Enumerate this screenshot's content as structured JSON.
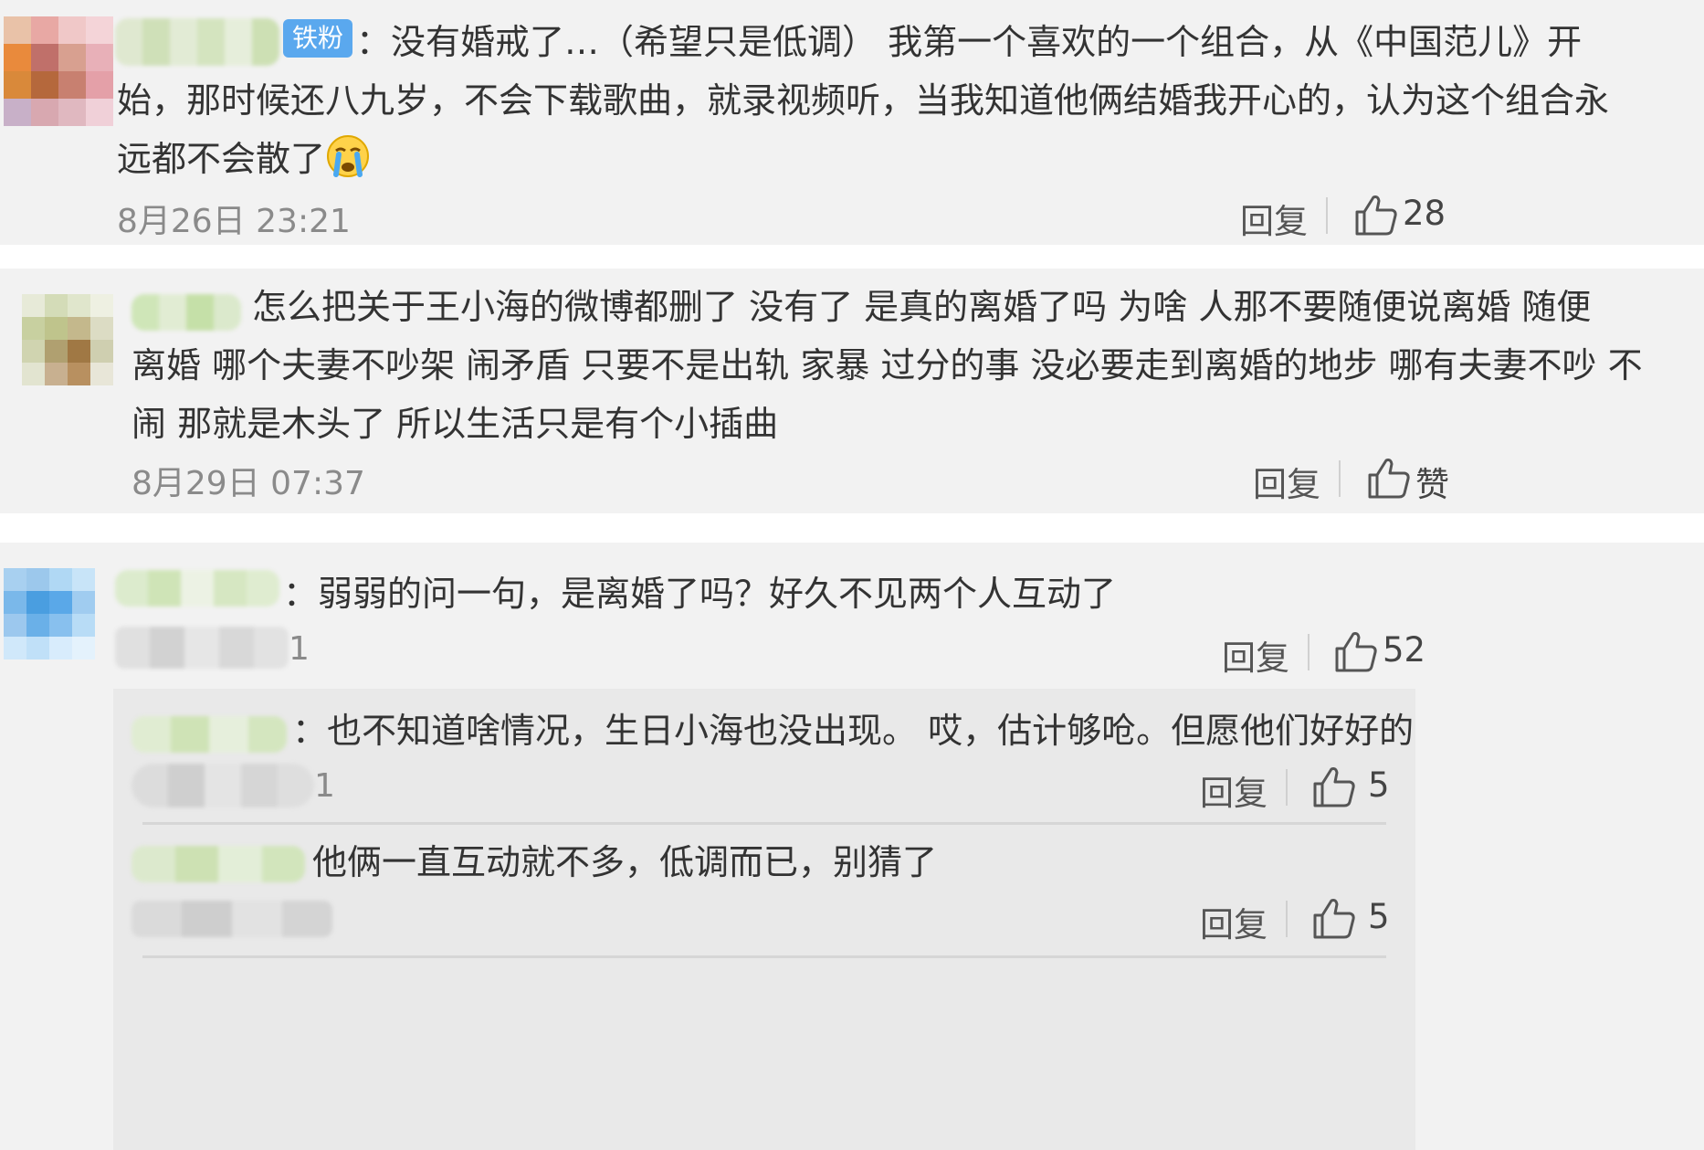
{
  "comments": [
    {
      "badge": "铁粉",
      "text_line1": "：没有婚戒了…（希望只是低调） 我第一个喜欢的一个组合，从《中国范儿》开",
      "text_line2": "始，那时候还八九岁，不会下载歌曲，就录视频听，当我知道他俩结婚我开心的，认为这个组合永",
      "text_line3": "远都不会散了",
      "emoji": "cry-emoji",
      "time": "8月26日 23:21",
      "reply_label": "回复",
      "like_count": "28"
    },
    {
      "text_line1": "怎么把关于王小海的微博都删了 没有了 是真的离婚了吗 为啥 人那不要随便说离婚 随便",
      "text_line2": "离婚 哪个夫妻不吵架 闹矛盾 只要不是出轨 家暴 过分的事 没必要走到离婚的地步 哪有夫妻不吵 不",
      "text_line3": "闹 那就是木头了 所以生活只是有个小插曲",
      "time": "8月29日 07:37",
      "reply_label": "回复",
      "like_label": "赞"
    },
    {
      "text_line1": "：弱弱的问一句，是离婚了吗？好久不见两个人互动了",
      "time_partial": "1",
      "reply_label": "回复",
      "like_count": "52",
      "replies": [
        {
          "text": "：也不知道啥情况，生日小海也没出现。 哎，估计够呛。但愿他们好好的",
          "time_partial": "1",
          "reply_label": "回复",
          "like_count": "5"
        },
        {
          "text": "他俩一直互动就不多，低调而已，别猜了",
          "reply_label": "回复",
          "like_count": "5"
        }
      ]
    }
  ],
  "colors": {
    "card_bg": "#f2f2f2",
    "sub_bg": "#e9e9e9",
    "badge_bg": "#5aa8ee",
    "text": "#333333",
    "meta": "#8a8a8a"
  },
  "icons": [
    "thumbs-up-icon",
    "cry-emoji"
  ]
}
